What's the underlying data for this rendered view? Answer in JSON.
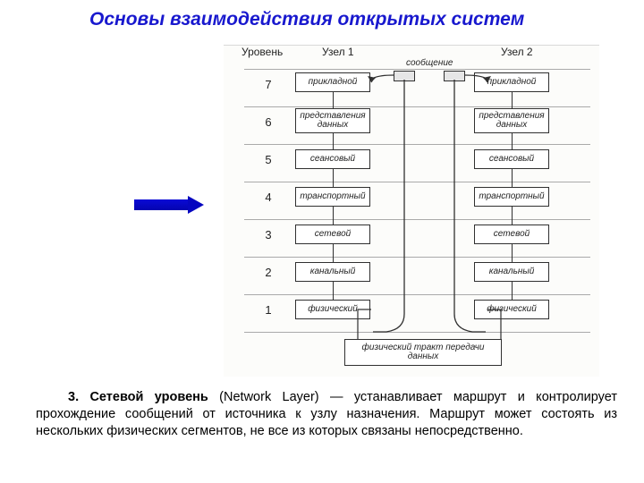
{
  "title": "Основы взаимодействия открытых систем",
  "headers": {
    "level": "Уровень",
    "node1": "Узел 1",
    "node2": "Узел 2"
  },
  "levels": [
    "7",
    "6",
    "5",
    "4",
    "3",
    "2",
    "1"
  ],
  "layers": {
    "l7": "прикладной",
    "l6": "представления данных",
    "l5": "сеансовый",
    "l4": "транспортный",
    "l3": "сетевой",
    "l2": "канальный",
    "l1": "физический"
  },
  "message_label": "сообщение",
  "bottom_path": "физический тракт передачи данных",
  "paragraph": {
    "num": "3.",
    "strong": "Сетевой уровень",
    "rest": " (Network Layer) — устанавливает маршрут и контролирует прохождение сообщений от источника к узлу назначения. Маршрут может состоять из нескольких физических сегментов, не все из которых связаны непосредственно."
  }
}
